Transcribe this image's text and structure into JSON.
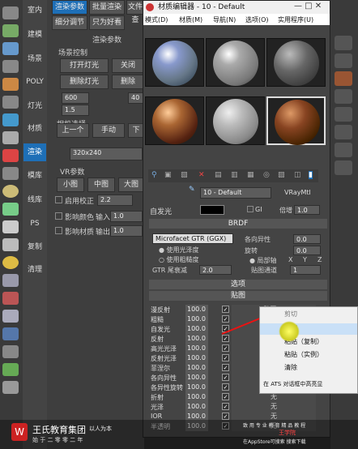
{
  "left_tabs": [
    "室内",
    "建模",
    "场景",
    "POLY",
    "灯光",
    "材质",
    "渲染",
    "模库",
    "线库",
    "PS",
    "复制",
    "清理"
  ],
  "left_active": "渲染",
  "mid": {
    "tabs": [
      "渲染参数",
      "批量渲染",
      "文件查"
    ],
    "sub_tabs": [
      "细分调节",
      "只为好看",
      "只"
    ],
    "section": "渲染参数",
    "scene_ctrl": "场景控制",
    "open_light": "打开灯光",
    "close_light": "关闭",
    "del_light": "删除灯光",
    "del": "删除",
    "v600": "600",
    "v400": "40",
    "v15": "1.5",
    "cam": "相机选择",
    "prev": "上一个",
    "manual": "手动",
    "next": "下",
    "res": "320x240",
    "vr": "VR参数",
    "small": "小图",
    "medium": "中图",
    "large": "大图",
    "enable": "启用",
    "correct": "校正",
    "val22": "2.2",
    "affect_color": "影响颜色",
    "input": "输入",
    "v10": "1.0",
    "affect_mat": "影响材质",
    "output": "输出"
  },
  "me": {
    "title": "材质编辑器 - 10 - Default",
    "menus": [
      "模式(D)",
      "材质(M)",
      "导航(N)",
      "选项(O)",
      "实用程序(U)"
    ],
    "mat_name": "10 - Default",
    "mat_type": "VRayMtl",
    "self_illum": "自发光",
    "gi": "GI",
    "mult": "倍增",
    "mult_v": "1.0",
    "brdf": "BRDF",
    "brdf_type": "Microfacet GTR (GGX)",
    "aniso": "各向异性",
    "aniso_v": "0.0",
    "rot": "旋转",
    "rot_v": "0.0",
    "use_gloss": "使用光泽度",
    "use_rough": "使用粗糙度",
    "local_axis": "局部轴",
    "x": "X",
    "y": "Y",
    "z": "Z",
    "gtr": "GTR 尾衰减",
    "gtr_v": "2.0",
    "map_ch": "贴图通道",
    "map_ch_v": "1",
    "options": "选项",
    "maps": "贴图",
    "rows": [
      {
        "n": "漫反射",
        "v": "100.0",
        "m": "贴图 #",
        "c": "✓"
      },
      {
        "n": "粗糙",
        "v": "100.0",
        "m": "",
        "c": "✓"
      },
      {
        "n": "自发光",
        "v": "100.0",
        "m": "",
        "c": "✓"
      },
      {
        "n": "反射",
        "v": "100.0",
        "m": "",
        "c": "✓"
      },
      {
        "n": "高光光泽",
        "v": "100.0",
        "m": "",
        "c": "✓"
      },
      {
        "n": "反射光泽",
        "v": "100.0",
        "m": "",
        "c": "✓"
      },
      {
        "n": "菲涅尔",
        "v": "100.0",
        "m": "",
        "c": "✓"
      },
      {
        "n": "各向异性",
        "v": "100.0",
        "m": "",
        "c": "✓"
      },
      {
        "n": "各异性旋转",
        "v": "100.0",
        "m": "",
        "c": "✓"
      },
      {
        "n": "折射",
        "v": "100.0",
        "m": "无",
        "c": "✓"
      },
      {
        "n": "光泽",
        "v": "100.0",
        "m": "无",
        "c": "✓"
      },
      {
        "n": "IOR",
        "v": "100.0",
        "m": "无",
        "c": "✓"
      },
      {
        "n": "半透明",
        "v": "100.0",
        "m": "无",
        "c": "✓"
      },
      {
        "n": "雾颜色",
        "v": "100.0",
        "m": "无",
        "c": "✓"
      },
      {
        "n": "凹凸",
        "v": "30.0",
        "m": "无",
        "c": "✓"
      }
    ]
  },
  "ctx": {
    "items": [
      "剪切",
      "复制",
      "粘贴（复制）",
      "粘贴（实例）",
      "清除",
      "在 ATS 对话框中高亮显"
    ]
  },
  "footer": {
    "logo": "王氏教育集团",
    "slogan": "以人为本",
    "sub": "始 于 二 零 零 二 年",
    "r1": "致 用 专 业 教 育 精 品 教 程",
    "r2": "在AppStore可搜索 搜索下载",
    "brand": "王学院"
  },
  "colors": {
    "accent": "#1e6fb7",
    "ctx_highlight": "#c9e0f7",
    "red_box": "#e11"
  }
}
